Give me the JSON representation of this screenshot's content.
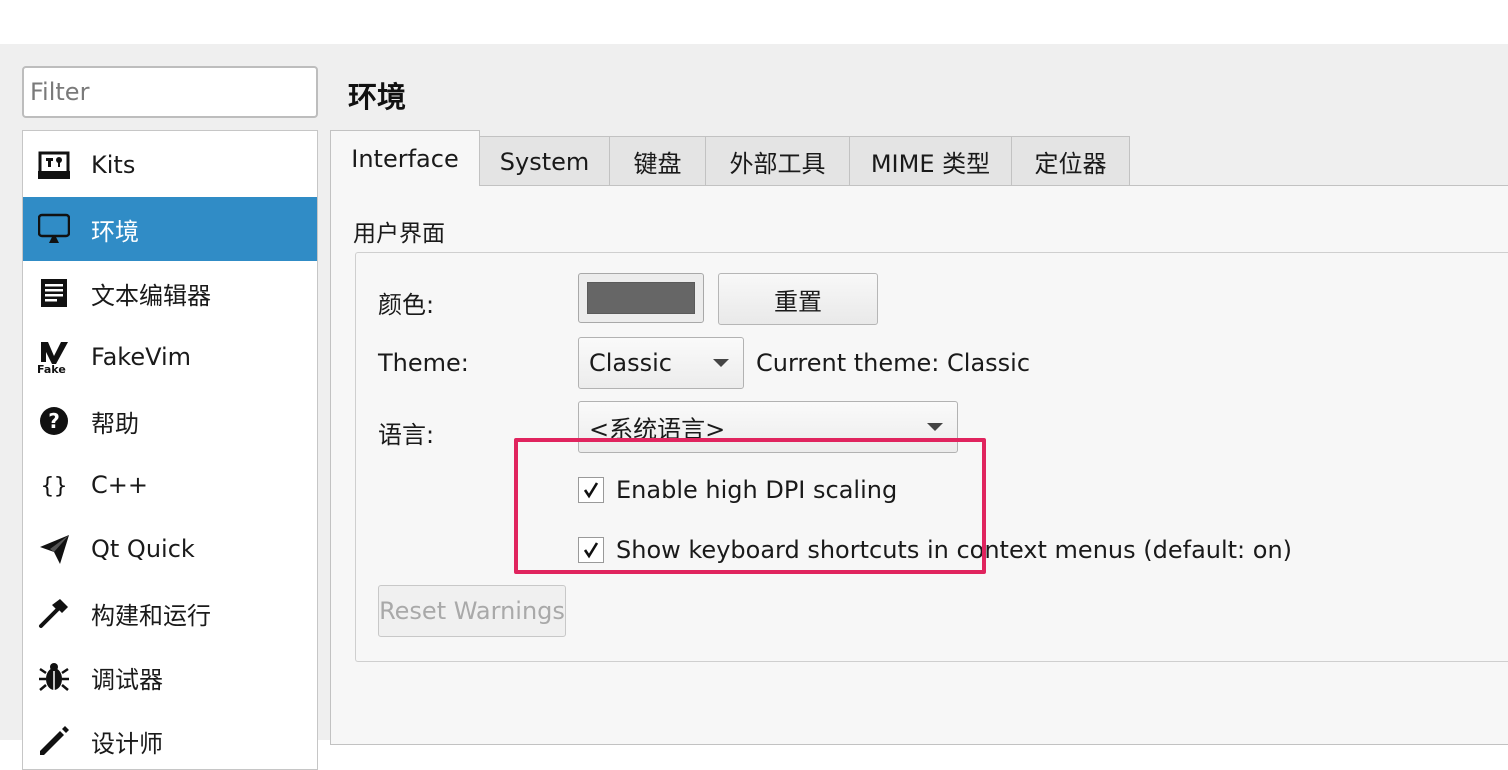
{
  "filter": {
    "placeholder": "Filter"
  },
  "sidebar": {
    "items": [
      {
        "label": "Kits",
        "icon": "kits-icon",
        "selected": false
      },
      {
        "label": "环境",
        "icon": "monitor-icon",
        "selected": true
      },
      {
        "label": "文本编辑器",
        "icon": "text-editor-icon",
        "selected": false
      },
      {
        "label": "FakeVim",
        "icon": "fakevim-icon",
        "selected": false
      },
      {
        "label": "帮助",
        "icon": "help-icon",
        "selected": false
      },
      {
        "label": "C++",
        "icon": "braces-icon",
        "selected": false
      },
      {
        "label": "Qt Quick",
        "icon": "paper-plane-icon",
        "selected": false
      },
      {
        "label": "构建和运行",
        "icon": "hammer-icon",
        "selected": false
      },
      {
        "label": "调试器",
        "icon": "bug-icon",
        "selected": false
      },
      {
        "label": "设计师",
        "icon": "pencil-icon",
        "selected": false
      }
    ]
  },
  "page": {
    "title": "环境"
  },
  "tabs": [
    {
      "label": "Interface",
      "active": true
    },
    {
      "label": "System",
      "active": false
    },
    {
      "label": "键盘",
      "active": false
    },
    {
      "label": "外部工具",
      "active": false
    },
    {
      "label": "MIME 类型",
      "active": false
    },
    {
      "label": "定位器",
      "active": false
    }
  ],
  "interface": {
    "group_title": "用户界面",
    "color_label": "颜色:",
    "color_value": "#666666",
    "reset_label": "重置",
    "theme_label": "Theme:",
    "theme_value": "Classic",
    "current_theme": "Current theme: Classic",
    "language_label": "语言:",
    "language_value": "<系统语言>",
    "high_dpi_label": "Enable high DPI scaling",
    "high_dpi_checked": true,
    "shortcuts_label": "Show keyboard shortcuts in context menus (default: on)",
    "shortcuts_checked": true,
    "reset_warnings_label": "Reset Warnings"
  },
  "colors": {
    "selection": "#308cc6",
    "highlight_box": "#e0245e"
  }
}
